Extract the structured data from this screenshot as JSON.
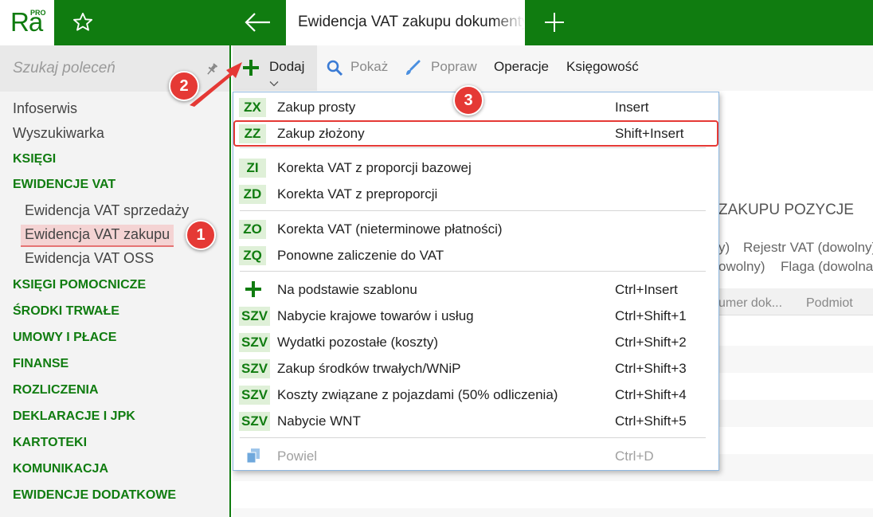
{
  "app": {
    "logo_text": "Ra",
    "logo_badge": "PRO",
    "tab_title": "Ewidencja VAT zakupu dokumenty"
  },
  "sidebar": {
    "search_placeholder": "Szukaj poleceń",
    "items": [
      {
        "label": "Infoserwis",
        "kind": "plain"
      },
      {
        "label": "Wyszukiwarka",
        "kind": "plain"
      },
      {
        "label": "KSIĘGI",
        "kind": "section"
      },
      {
        "label": "EWIDENCJE VAT",
        "kind": "section"
      },
      {
        "label": "Ewidencja VAT sprzedaży",
        "kind": "sub"
      },
      {
        "label": "Ewidencja VAT zakupu",
        "kind": "sub",
        "selected": true
      },
      {
        "label": "Ewidencja VAT OSS",
        "kind": "sub"
      },
      {
        "label": "KSIĘGI POMOCNICZE",
        "kind": "section"
      },
      {
        "label": "ŚRODKI TRWAŁE",
        "kind": "section"
      },
      {
        "label": "UMOWY I PŁACE",
        "kind": "section"
      },
      {
        "label": "FINANSE",
        "kind": "section"
      },
      {
        "label": "ROZLICZENIA",
        "kind": "section"
      },
      {
        "label": "DEKLARACJE I JPK",
        "kind": "section"
      },
      {
        "label": "KARTOTEKI",
        "kind": "section"
      },
      {
        "label": "KOMUNIKACJA",
        "kind": "section"
      },
      {
        "label": "EWIDENCJE DODATKOWE",
        "kind": "section"
      }
    ]
  },
  "toolbar": {
    "dodaj": "Dodaj",
    "pokaz": "Pokaż",
    "popraw": "Popraw",
    "operacje": "Operacje",
    "ksiegowosc": "Księgowość"
  },
  "background": {
    "title": "ZAKUPU POZYCJE",
    "filter1a": "y)",
    "filter1b": "Rejestr VAT (dowolny)",
    "filter2a": "owolny)",
    "filter2b": "Flaga (dowolna)",
    "col1": "umer dok...",
    "col2": "Podmiot"
  },
  "menu": {
    "items": [
      {
        "code": "ZX",
        "label": "Zakup prosty",
        "shortcut": "Insert"
      },
      {
        "code": "ZZ",
        "label": "Zakup złożony",
        "shortcut": "Shift+Insert"
      },
      {
        "code": "ZI",
        "label": "Korekta VAT z proporcji bazowej",
        "shortcut": ""
      },
      {
        "code": "ZD",
        "label": "Korekta VAT z preproporcji",
        "shortcut": ""
      },
      {
        "code": "ZO",
        "label": "Korekta VAT (nieterminowe płatności)",
        "shortcut": ""
      },
      {
        "code": "ZQ",
        "label": "Ponowne zaliczenie do VAT",
        "shortcut": ""
      },
      {
        "code": "",
        "icon": "plus-icon",
        "label": "Na podstawie szablonu",
        "shortcut": "Ctrl+Insert"
      },
      {
        "code": "SZV",
        "label": "Nabycie krajowe towarów i usług",
        "shortcut": "Ctrl+Shift+1"
      },
      {
        "code": "SZV",
        "label": "Wydatki pozostałe (koszty)",
        "shortcut": "Ctrl+Shift+2"
      },
      {
        "code": "SZV",
        "label": "Zakup środków trwałych/WNiP",
        "shortcut": "Ctrl+Shift+3"
      },
      {
        "code": "SZV",
        "label": "Koszty związane z pojazdami (50% odliczenia)",
        "shortcut": "Ctrl+Shift+4"
      },
      {
        "code": "SZV",
        "label": "Nabycie WNT",
        "shortcut": "Ctrl+Shift+5"
      },
      {
        "code": "",
        "icon": "copy-icon",
        "label": "Powiel",
        "shortcut": "Ctrl+D",
        "disabled": true
      }
    ]
  },
  "annotations": {
    "badge1": "1",
    "badge2": "2",
    "badge3": "3"
  },
  "colors": {
    "brand_green": "#107c10",
    "code_bg": "#dff0d8",
    "annotation_red": "#e53935"
  }
}
